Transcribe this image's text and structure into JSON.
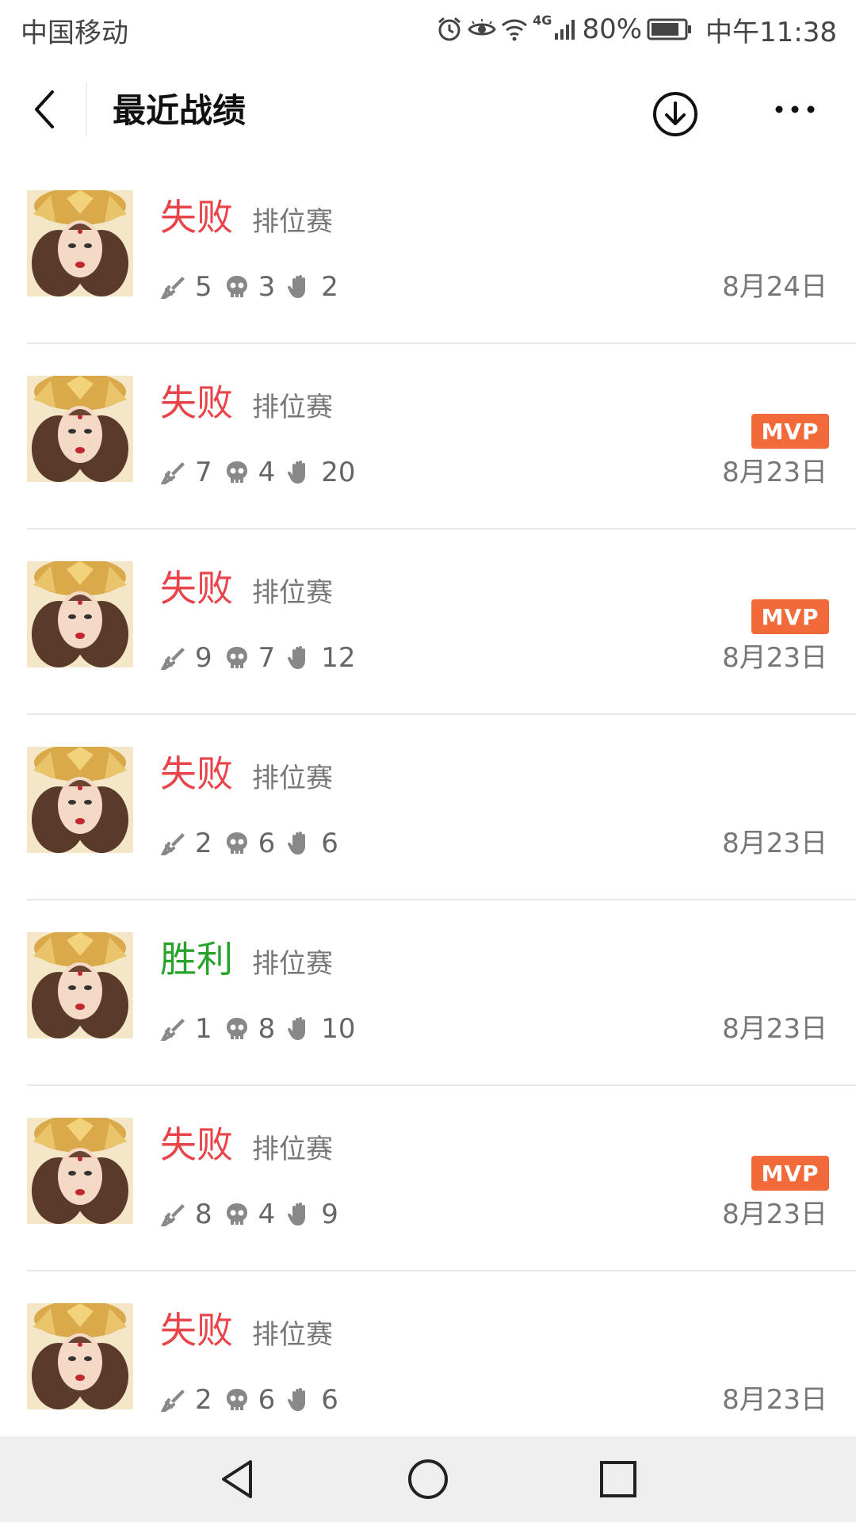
{
  "status_bar": {
    "carrier": "中国移动",
    "network_badge": "4G",
    "battery": "80%",
    "time": "中午11:38",
    "icons": [
      "alarm-icon",
      "eye-icon",
      "wifi-icon",
      "signal-icon",
      "battery-icon"
    ]
  },
  "header": {
    "title": "最近战绩",
    "icons": [
      "back-arrow-icon",
      "download-icon",
      "more-icon"
    ]
  },
  "matches": [
    {
      "result": "失败",
      "result_type": "loss",
      "mode": "排位赛",
      "kills": "5",
      "deaths": "3",
      "assists": "2",
      "mvp": false,
      "date": "8月24日"
    },
    {
      "result": "失败",
      "result_type": "loss",
      "mode": "排位赛",
      "kills": "7",
      "deaths": "4",
      "assists": "20",
      "mvp": true,
      "date": "8月23日"
    },
    {
      "result": "失败",
      "result_type": "loss",
      "mode": "排位赛",
      "kills": "9",
      "deaths": "7",
      "assists": "12",
      "mvp": true,
      "date": "8月23日"
    },
    {
      "result": "失败",
      "result_type": "loss",
      "mode": "排位赛",
      "kills": "2",
      "deaths": "6",
      "assists": "6",
      "mvp": false,
      "date": "8月23日"
    },
    {
      "result": "胜利",
      "result_type": "win",
      "mode": "排位赛",
      "kills": "1",
      "deaths": "8",
      "assists": "10",
      "mvp": false,
      "date": "8月23日"
    },
    {
      "result": "失败",
      "result_type": "loss",
      "mode": "排位赛",
      "kills": "8",
      "deaths": "4",
      "assists": "9",
      "mvp": true,
      "date": "8月23日"
    },
    {
      "result": "失败",
      "result_type": "loss",
      "mode": "排位赛",
      "kills": "2",
      "deaths": "6",
      "assists": "6",
      "mvp": false,
      "date": "8月23日"
    }
  ],
  "mvp_label": "MVP",
  "colors": {
    "loss": "#e8444a",
    "win": "#27a32a",
    "mvp": "#f26a3a"
  },
  "nav_bar": {
    "icons": [
      "nav-back-icon",
      "nav-home-icon",
      "nav-recents-icon"
    ]
  }
}
